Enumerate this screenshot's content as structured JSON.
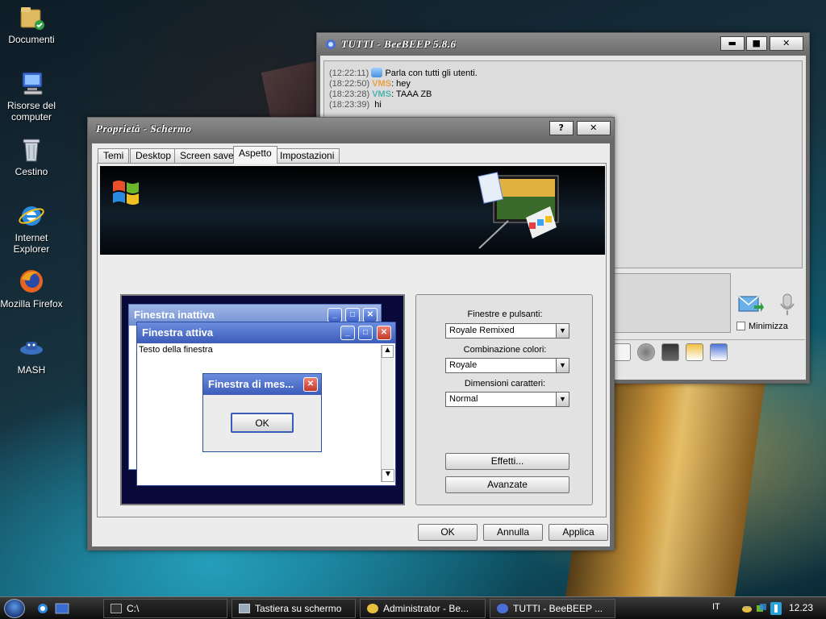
{
  "desktop": {
    "icons": [
      {
        "label": "Documenti",
        "icon": "folder-user-icon"
      },
      {
        "label": "Risorse del computer",
        "icon": "computer-icon"
      },
      {
        "label": "Cestino",
        "icon": "recycle-bin-icon"
      },
      {
        "label": "Internet Explorer",
        "icon": "internet-explorer-icon"
      },
      {
        "label": "Mozilla Firefox",
        "icon": "firefox-icon"
      },
      {
        "label": "MASH",
        "icon": "mash-icon"
      }
    ]
  },
  "beebeep": {
    "title": "TUTTI - BeeBEEP 5.8.6",
    "minimize_label": "▬",
    "maximize_label": "■",
    "close_label": "✕",
    "messages": [
      {
        "time": "(12:22:11)",
        "user": "",
        "text": "Parla con tutti gli utenti."
      },
      {
        "time": "(18:22:50)",
        "user": "VMS",
        "text": ": hey"
      },
      {
        "time": "(18:23:28)",
        "user": "VMS",
        "text": ": TAAA ZB"
      },
      {
        "time": "(18:23:39)",
        "user": "",
        "text": "hi"
      }
    ],
    "minimize_checkbox_label": "Minimizza",
    "colors": {
      "user_orange": "#e8a040",
      "user_cyan": "#50b0b0"
    }
  },
  "props": {
    "title": "Proprietà - Schermo",
    "help_label": "?",
    "close_label": "✕",
    "tabs": [
      "Temi",
      "Desktop",
      "Screen saver",
      "Aspetto",
      "Impostazioni"
    ],
    "active_tab": "Aspetto",
    "preview": {
      "inactive_title": "Finestra inattiva",
      "active_title": "Finestra attiva",
      "window_text": "Testo della finestra",
      "message_title": "Finestra di mes...",
      "message_ok": "OK"
    },
    "settings": {
      "windows_buttons_label": "Finestre e pulsanti:",
      "windows_buttons_value": "Royale Remixed",
      "color_scheme_label": "Combinazione colori:",
      "color_scheme_value": "Royale",
      "font_size_label": "Dimensioni caratteri:",
      "font_size_value": "Normal",
      "effects_button": "Effetti...",
      "advanced_button": "Avanzate"
    },
    "buttons": {
      "ok": "OK",
      "cancel": "Annulla",
      "apply": "Applica"
    }
  },
  "taskbar": {
    "items": [
      {
        "label": "C:\\",
        "icon": "console-icon"
      },
      {
        "label": "Tastiera su schermo",
        "icon": "keyboard-icon"
      },
      {
        "label": "Administrator - Be...",
        "icon": "bee-icon"
      },
      {
        "label": "TUTTI - BeeBEEP ...",
        "icon": "beebeep-icon"
      }
    ],
    "language": "IT",
    "clock": "12.23"
  }
}
